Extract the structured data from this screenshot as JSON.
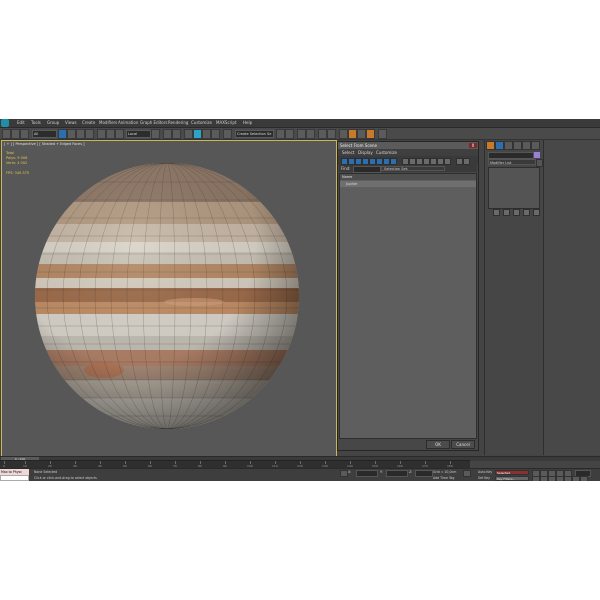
{
  "menubar": {
    "menus": [
      "Edit",
      "Tools",
      "Group",
      "Views",
      "Create",
      "Modifiers",
      "Animation",
      "Graph Editors",
      "Rendering",
      "Customize",
      "MAXScript",
      "Help"
    ]
  },
  "toolbar": {
    "filter_select": "All",
    "ref_coord_select": "Local",
    "named_selection": "Create Selection Se"
  },
  "viewport": {
    "label": "[ + ] [ Perspective ] [ Shaded + Edged Faces ]",
    "stats_header": "Total",
    "polys": "Polys:   9 006",
    "verts": "Verts:   4 002",
    "fps": "FPS:    340.375"
  },
  "scene_dialog": {
    "title": "Select From Scene",
    "close": "X",
    "menus": [
      "Select",
      "Display",
      "Customize"
    ],
    "find_label": "Find:",
    "selection_set": "Selection Set:",
    "column_header": "Name",
    "objects": [
      "Jupiter"
    ],
    "ok": "OK",
    "cancel": "Cancel"
  },
  "command_panel": {
    "modifier_list": "Modifier List"
  },
  "timeline": {
    "frame": "0 / 100",
    "ticks": [
      "0",
      "10",
      "20",
      "30",
      "40",
      "50",
      "60",
      "70",
      "80",
      "90",
      "100",
      "110",
      "120",
      "130",
      "140",
      "150",
      "160",
      "170",
      "180"
    ]
  },
  "status": {
    "maxscript_mini": "Max to Physc",
    "selection": "None Selected",
    "prompt": "Click or click-and-drag to select objects",
    "grid": "Grid = 10,0cm",
    "add_time_tag": "Add Time Tag",
    "auto_key": "Auto Key",
    "set_key": "Set Key",
    "selected": "Selected",
    "key_filters": "Key Filters..."
  },
  "colors": {
    "app_bg": "#444444",
    "viewport_bg": "#575757",
    "active_border": "#c9b65a",
    "stats": "#e6c34c",
    "accent_blue": "#2c6fb1",
    "auto_key_red": "#8a3030"
  }
}
